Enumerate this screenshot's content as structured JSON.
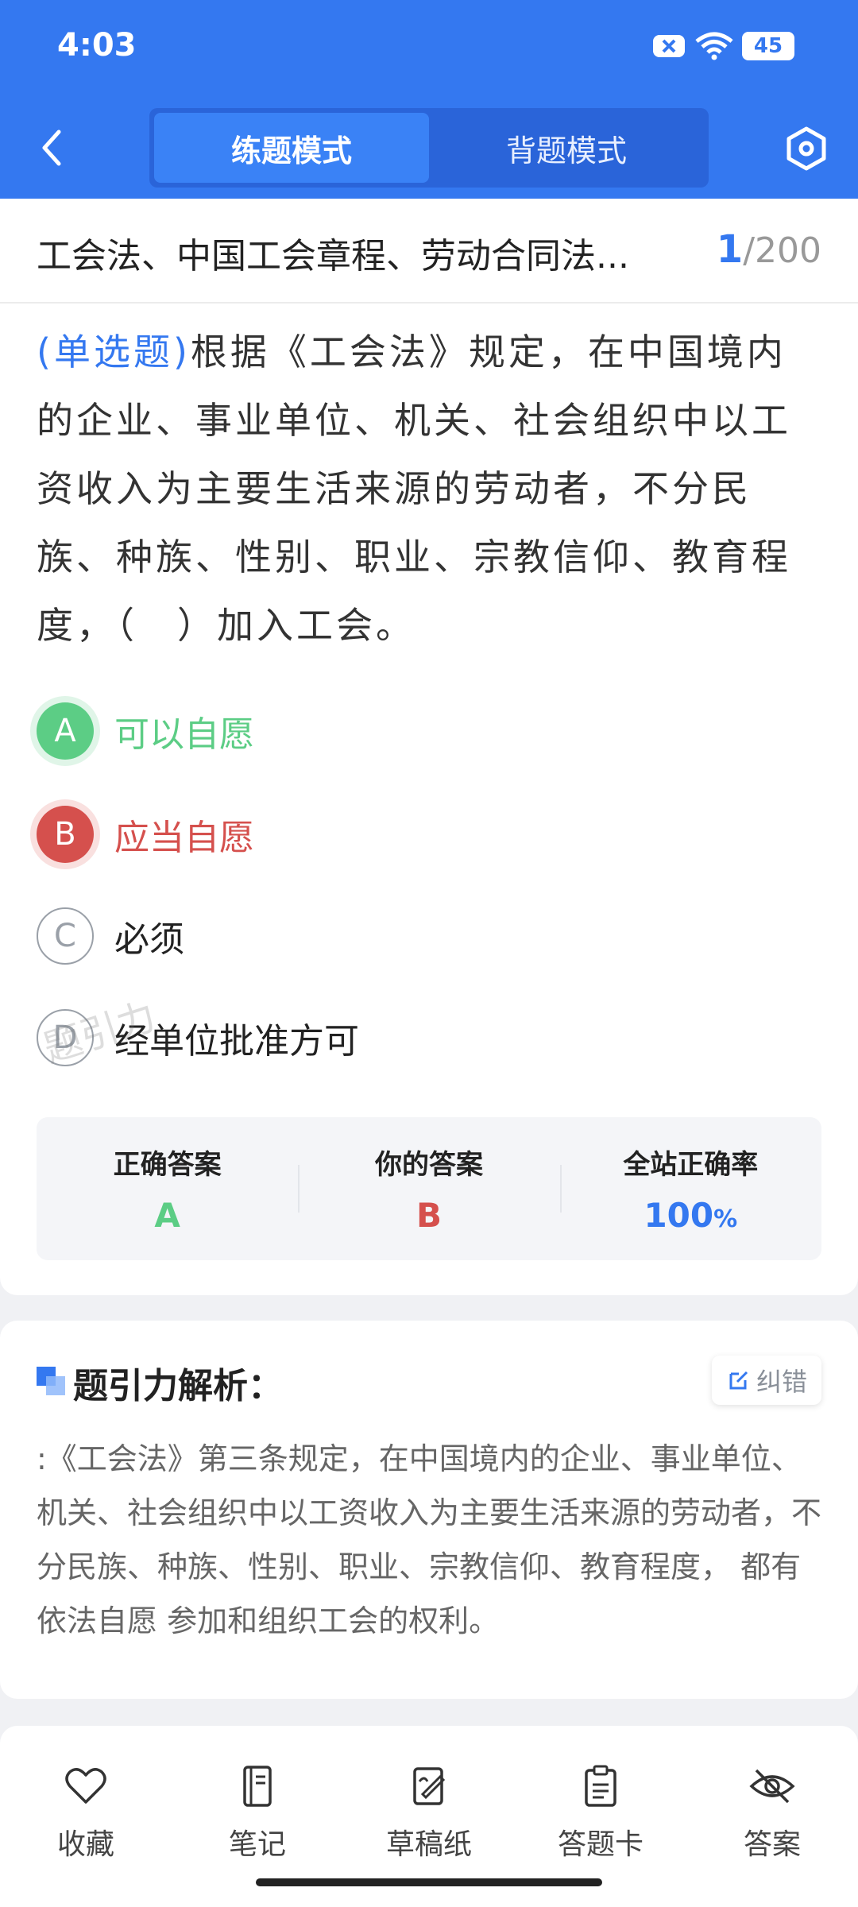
{
  "status": {
    "time": "4:03",
    "battery": "45"
  },
  "header": {
    "tabs": [
      "练题模式",
      "背题模式"
    ],
    "active_tab": 0
  },
  "question": {
    "subject": "工会法、中国工会章程、劳动合同法...",
    "index": "1",
    "total": "/200",
    "type": "(单选题)",
    "text": "根据《工会法》规定，在中国境内的企业、事业单位、机关、社会组织中以工资收入为主要生活来源的劳动者，不分民族、种族、性别、职业、宗教信仰、教育程度，（　）加入工会。",
    "options": [
      {
        "letter": "A",
        "text": "可以自愿",
        "state": "correct"
      },
      {
        "letter": "B",
        "text": "应当自愿",
        "state": "wrong"
      },
      {
        "letter": "C",
        "text": "必须",
        "state": "plain"
      },
      {
        "letter": "D",
        "text": "经单位批准方可",
        "state": "plain"
      }
    ],
    "watermark": "题引力"
  },
  "stats": {
    "correct_label": "正确答案",
    "correct_value": "A",
    "your_label": "你的答案",
    "your_value": "B",
    "rate_label": "全站正确率",
    "rate_value": "100",
    "rate_unit": "%"
  },
  "analysis": {
    "title": "题引力解析：",
    "correct_btn": "纠错",
    "text": ":《工会法》第三条规定，在中国境内的企业、事业单位、机关、社会组织中以工资收入为主要生活来源的劳动者，不分民族、种族、性别、职业、宗教信仰、教育程度， 都有依法自愿 参加和组织工会的权利。"
  },
  "bottom_nav": [
    "收藏",
    "笔记",
    "草稿纸",
    "答题卡",
    "答案"
  ],
  "colors": {
    "primary": "#3478f0",
    "correct": "#5ccd85",
    "wrong": "#d5504d"
  }
}
